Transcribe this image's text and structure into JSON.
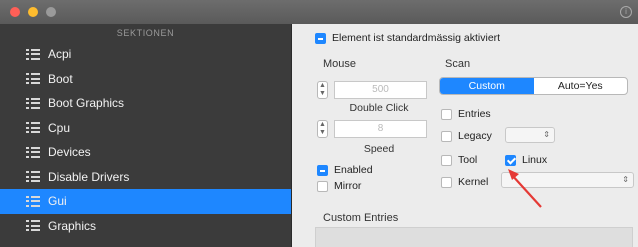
{
  "sidebar": {
    "header": "SEKTIONEN",
    "items": [
      {
        "label": "Acpi",
        "selected": false
      },
      {
        "label": "Boot",
        "selected": false
      },
      {
        "label": "Boot Graphics",
        "selected": false
      },
      {
        "label": "Cpu",
        "selected": false
      },
      {
        "label": "Devices",
        "selected": false
      },
      {
        "label": "Disable Drivers",
        "selected": false
      },
      {
        "label": "Gui",
        "selected": true
      },
      {
        "label": "Graphics",
        "selected": false
      }
    ]
  },
  "content": {
    "default_enabled_label": "Element ist standardmässig aktiviert",
    "mouse": {
      "title": "Mouse",
      "double_click_value": "500",
      "double_click_label": "Double Click",
      "speed_value": "8",
      "speed_label": "Speed",
      "enabled_label": "Enabled",
      "mirror_label": "Mirror"
    },
    "scan": {
      "title": "Scan",
      "segments": [
        "Custom",
        "Auto=Yes"
      ],
      "entries_label": "Entries",
      "legacy_label": "Legacy",
      "tool_label": "Tool",
      "linux_label": "Linux",
      "kernel_label": "Kernel"
    },
    "custom_entries_title": "Custom Entries"
  },
  "colors": {
    "accent": "#1e87ff",
    "sidebar_bg": "#3b3b3b",
    "annotation_arrow": "#e53935"
  }
}
